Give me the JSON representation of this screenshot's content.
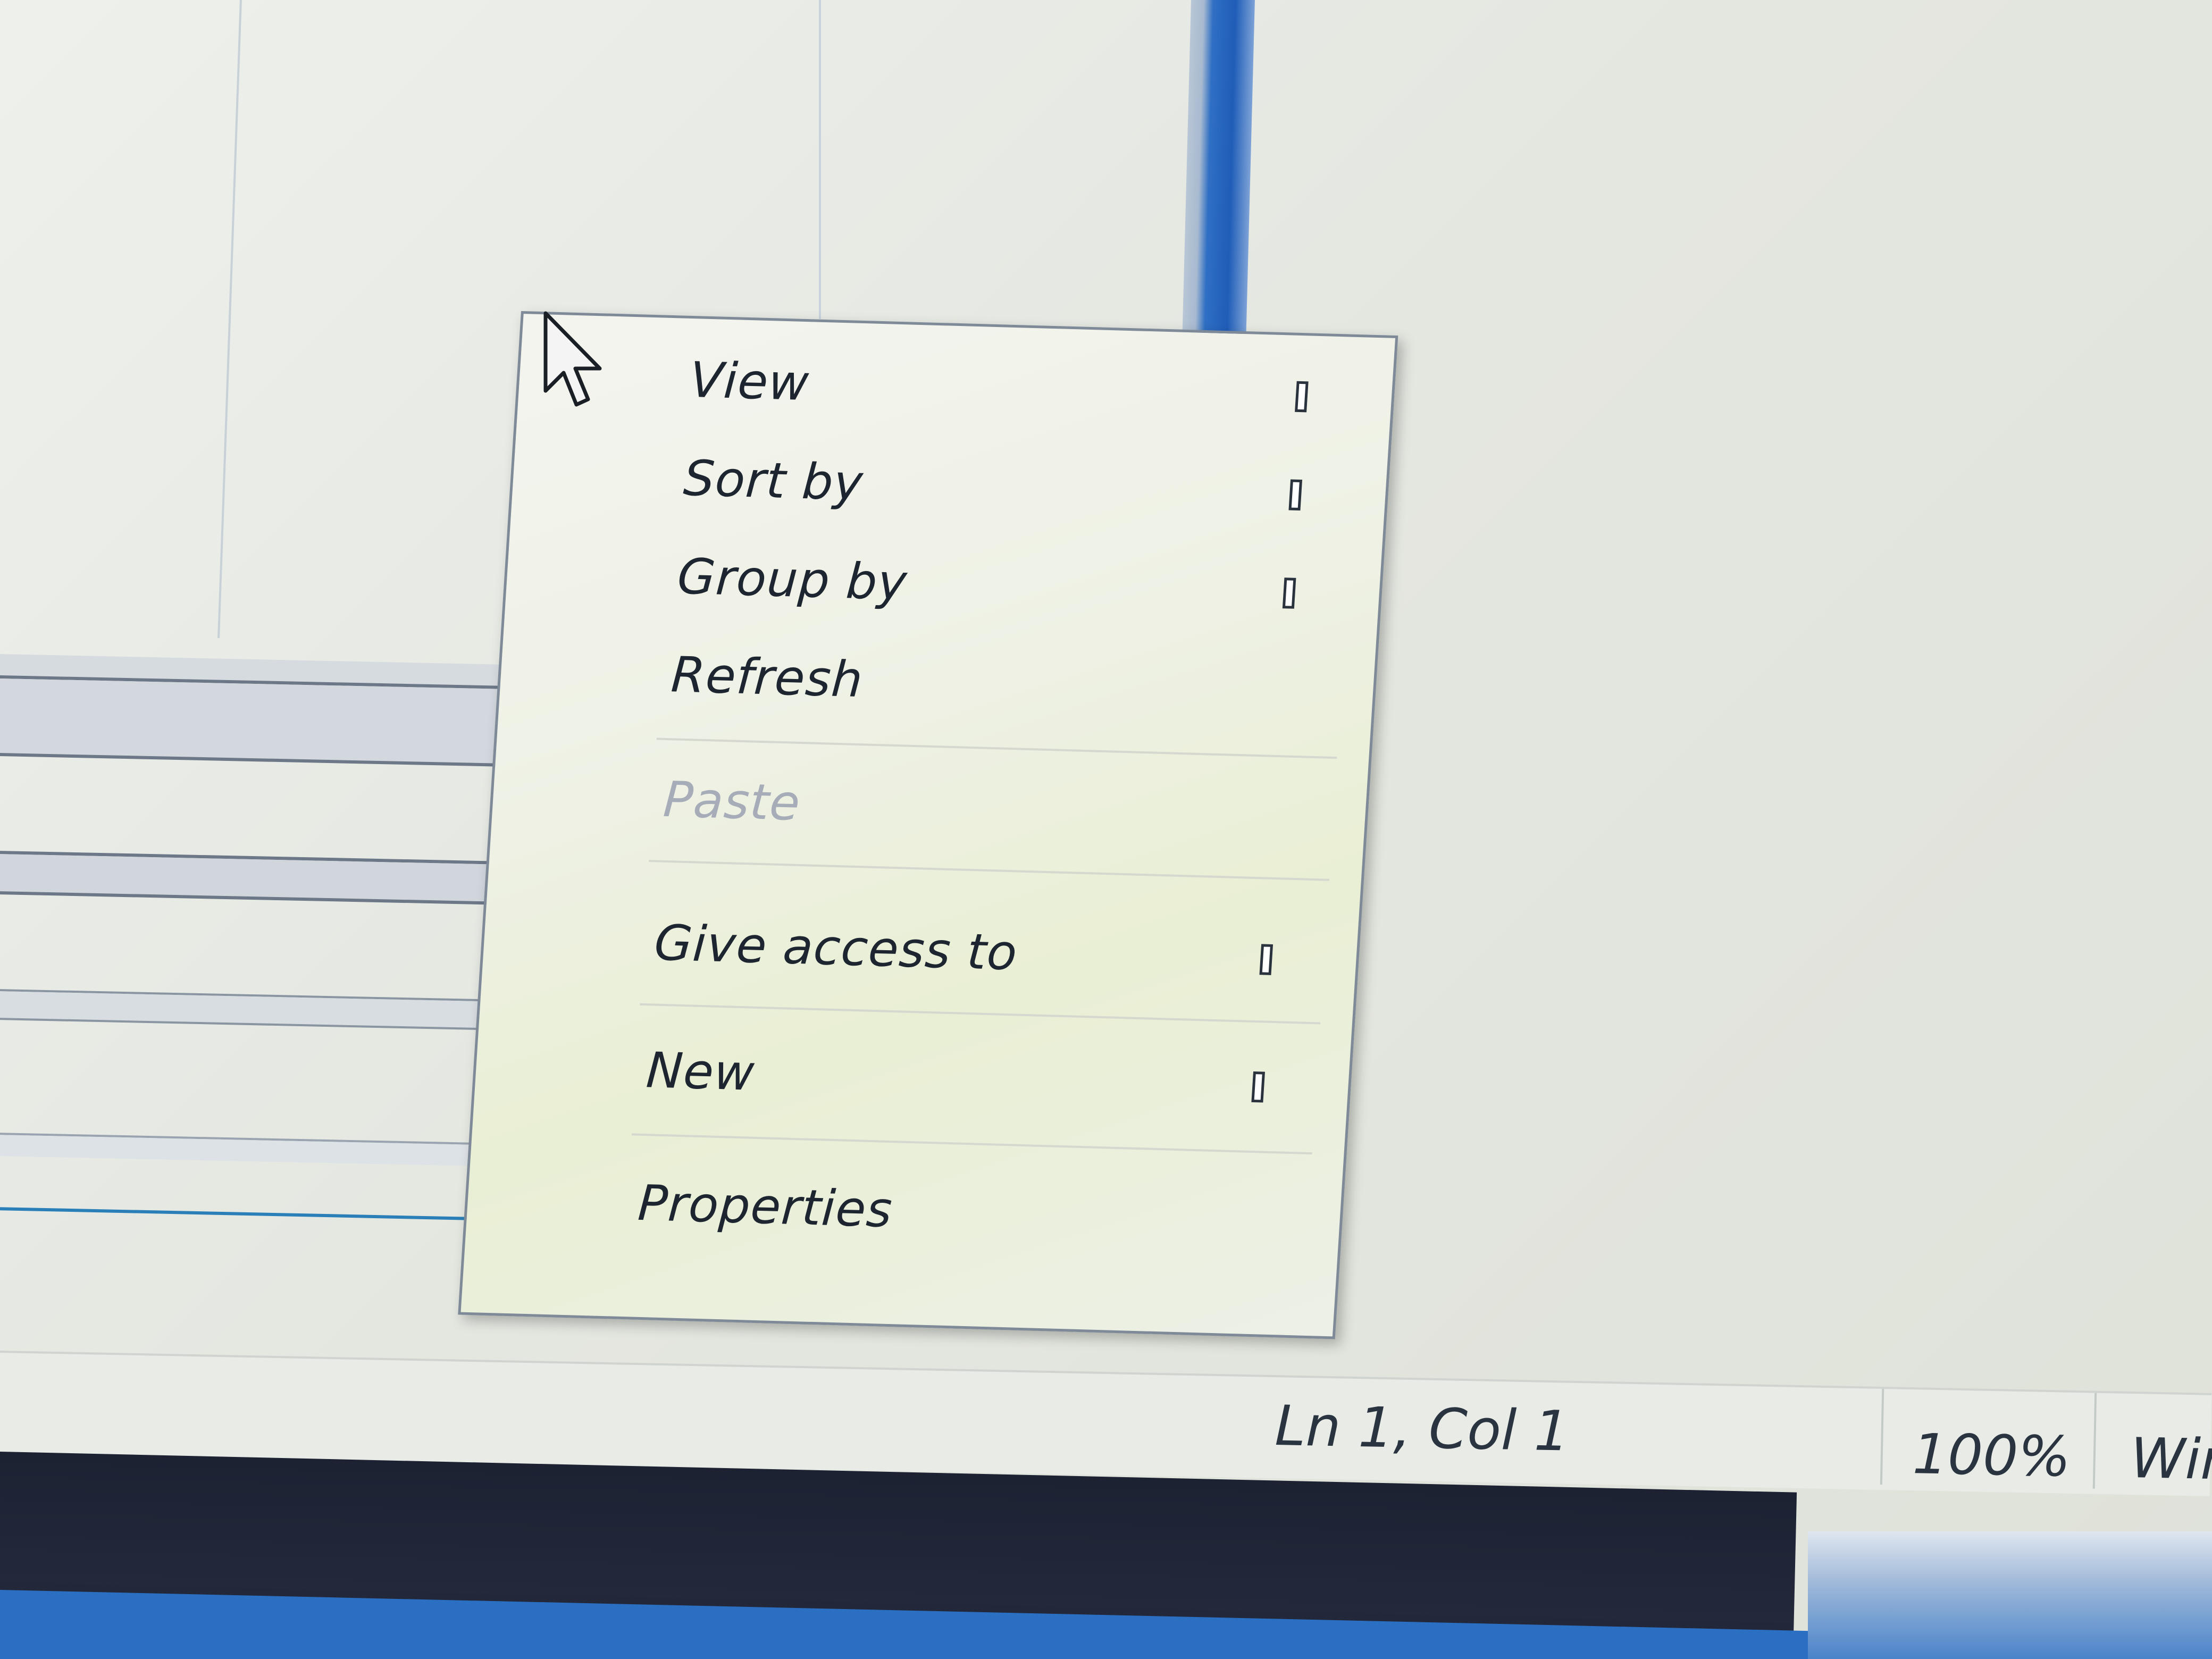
{
  "context_menu": {
    "items": [
      {
        "label": "View",
        "has_submenu": true,
        "disabled": false
      },
      {
        "label": "Sort by",
        "has_submenu": true,
        "disabled": false
      },
      {
        "label": "Group by",
        "has_submenu": true,
        "disabled": false
      },
      {
        "label": "Refresh",
        "has_submenu": false,
        "disabled": false
      },
      {
        "label": "Paste",
        "has_submenu": false,
        "disabled": true
      },
      {
        "label": "Give access to",
        "has_submenu": true,
        "disabled": false
      },
      {
        "label": "New",
        "has_submenu": true,
        "disabled": false
      },
      {
        "label": "Properties",
        "has_submenu": false,
        "disabled": false
      }
    ]
  },
  "status_bar": {
    "position": "Ln 1, Col 1",
    "zoom": "100%",
    "encoding": "Win"
  },
  "icons": {
    "cursor": "arrow-cursor-icon",
    "submenu": "submenu-arrow-icon"
  },
  "colors": {
    "accent_blue": "#2b6fc2",
    "taskbar_dark": "#1c2232",
    "menu_background": "#eef1e4",
    "disabled_text": "#a6adb8"
  }
}
